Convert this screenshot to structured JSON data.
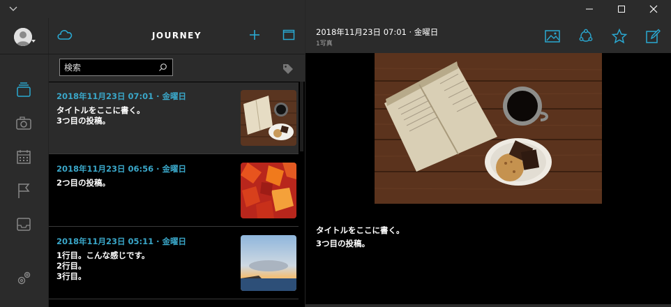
{
  "window": {
    "menu_icon": "chevron-down-icon",
    "controls": [
      "minimize-icon",
      "maximize-icon",
      "close-icon"
    ]
  },
  "sidebar": {
    "avatar_icon": "user-avatar-icon",
    "items": [
      {
        "icon": "journal-stack-icon",
        "active": true
      },
      {
        "icon": "camera-icon",
        "active": false
      },
      {
        "icon": "calendar-icon",
        "active": false
      },
      {
        "icon": "flag-icon",
        "active": false
      },
      {
        "icon": "inbox-tray-icon",
        "active": false
      }
    ],
    "settings_icon": "gear-icon"
  },
  "list": {
    "title": "JOURNEY",
    "search_placeholder": "検索",
    "entries": [
      {
        "date": "2018年11月23日 07:01 · 金曜日",
        "lines": [
          "タイトルをここに書く。",
          "3つ目の投稿。"
        ],
        "thumb": "book-coffee",
        "selected": true
      },
      {
        "date": "2018年11月23日 06:56 · 金曜日",
        "lines": [
          "2つ目の投稿。"
        ],
        "thumb": "autumn-leaves",
        "selected": false
      },
      {
        "date": "2018年11月23日 05:11 · 金曜日",
        "lines": [
          "1行目。こんな感じです。",
          "2行目。",
          "3行目。"
        ],
        "thumb": "sunset-sea",
        "selected": false
      }
    ]
  },
  "detail": {
    "datetime": "2018年11月23日 07:01 · 金曜日",
    "photo_count": "1写真",
    "toolbar_icons": [
      "image-icon",
      "share-icon",
      "star-icon",
      "edit-icon"
    ],
    "body_lines": [
      "タイトルをここに書く。",
      "3つ目の投稿。"
    ]
  },
  "colors": {
    "accent": "#2aa9d2",
    "date_text": "#3aa7c9",
    "panel": "#2b2b2b",
    "list_bg": "#000000"
  }
}
